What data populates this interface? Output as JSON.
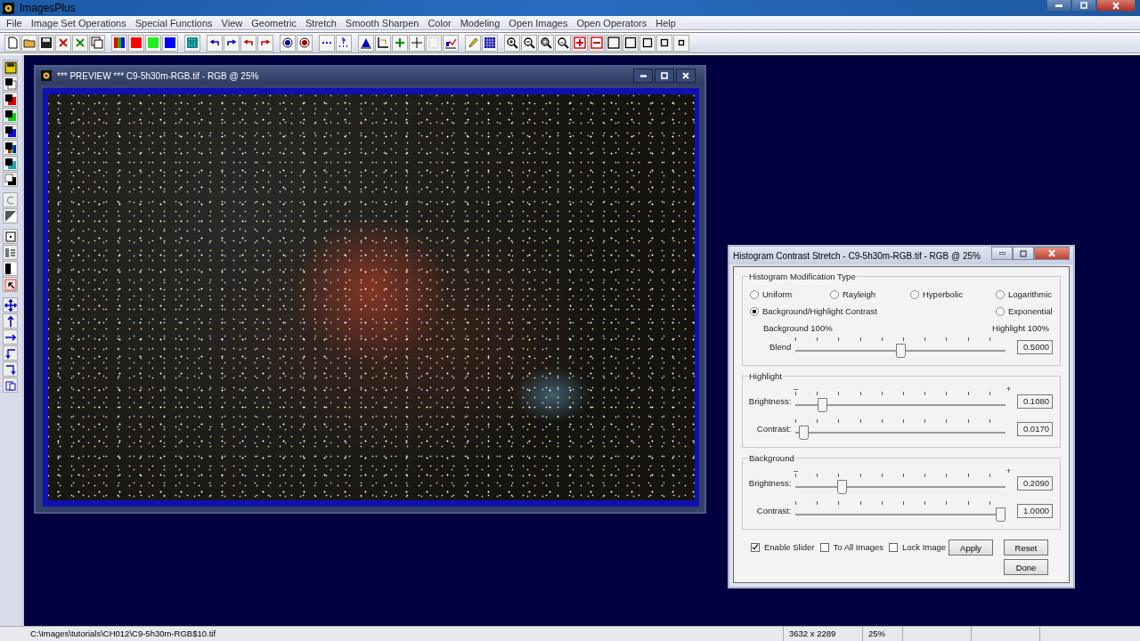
{
  "window": {
    "title": "ImagesPlus"
  },
  "menu": [
    {
      "label": "File"
    },
    {
      "label": "Image Set Operations"
    },
    {
      "label": "Special Functions"
    },
    {
      "label": "View"
    },
    {
      "label": "Geometric"
    },
    {
      "label": "Stretch"
    },
    {
      "label": "Smooth Sharpen"
    },
    {
      "label": "Color"
    },
    {
      "label": "Modeling"
    },
    {
      "label": "Open Images"
    },
    {
      "label": "Open Operators"
    },
    {
      "label": "Help"
    }
  ],
  "preview": {
    "title": "*** PREVIEW *** C9-5h30m-RGB.tif - RGB @ 25%"
  },
  "dialog": {
    "title": "Histogram Contrast Stretch - C9-5h30m-RGB.tif - RGB @ 25%",
    "modification": {
      "legend": "Histogram Modification Type",
      "options": [
        {
          "label": "Uniform",
          "selected": false
        },
        {
          "label": "Rayleigh",
          "selected": false
        },
        {
          "label": "Hyperbolic",
          "selected": false
        },
        {
          "label": "Logarithmic",
          "selected": false
        },
        {
          "label": "Background/Highlight Contrast",
          "selected": true
        },
        {
          "label": "Exponential",
          "selected": false
        }
      ],
      "blend": {
        "left_label": "Background 100%",
        "right_label": "Highlight 100%",
        "label": "Blend",
        "level": 0.5,
        "value": "0.5000"
      }
    },
    "groups": [
      {
        "legend": "Highlight",
        "minus": "–",
        "plus": "+",
        "sliders": [
          {
            "label": "Brightness:",
            "level": 0.108,
            "value": "0.1080"
          },
          {
            "label": "Contrast:",
            "level": 0.017,
            "value": "0.0170"
          }
        ]
      },
      {
        "legend": "Background",
        "minus": "–",
        "plus": "+",
        "sliders": [
          {
            "label": "Brightness:",
            "level": 0.209,
            "value": "0.2090"
          },
          {
            "label": "Contrast:",
            "level": 1.0,
            "value": "1.0000"
          }
        ]
      }
    ],
    "checkboxes": [
      {
        "label": "Enable Slider",
        "checked": true
      },
      {
        "label": "To All Images",
        "checked": false
      },
      {
        "label": "Lock Image",
        "checked": false
      }
    ],
    "buttons": [
      {
        "label": "Apply"
      },
      {
        "label": "Reset"
      },
      {
        "label": "Done"
      }
    ]
  },
  "status_bar": {
    "path": "C:\\Images\\tutorials\\CH012\\C9-5h30m-RGB$10.tif",
    "dimensions": "3632 x 2289",
    "zoom": "25%"
  }
}
